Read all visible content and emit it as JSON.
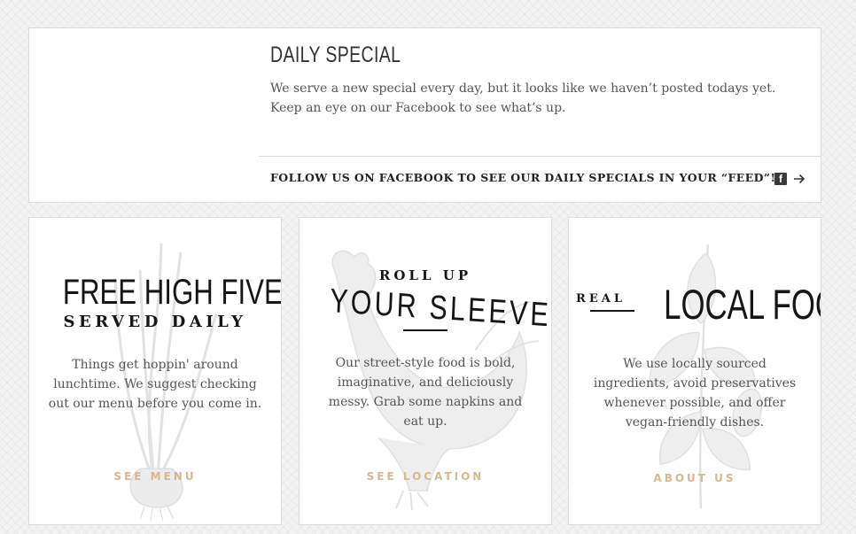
{
  "daily_special": {
    "title": "DAILY SPECIAL",
    "text": "We serve a new special every day, but it looks like we haven’t posted todays yet. Keep an eye on our Facebook to see what’s up.",
    "follow_text": "FOLLOW US ON FACEBOOK TO SEE OUR DAILY SPECIALS IN YOUR “FEED”!",
    "icons": [
      "facebook-icon",
      "arrow-right-icon"
    ]
  },
  "cards": [
    {
      "headline_main": "FREE HIGH FIVES",
      "headline_sub": "SERVED DAILY",
      "text": "Things get hoppin' around lunchtime. We suggest checking out our menu before you come in.",
      "link": "SEE MENU",
      "background_art": "scallion-illustration"
    },
    {
      "headline_top": "ROLL UP",
      "headline_main": "YOUR SLEEVES",
      "text": "Our street-style food is bold, imaginative, and deliciously messy. Grab some napkins and eat up.",
      "link": "SEE LOCATION",
      "background_art": "rooster-illustration"
    },
    {
      "headline_small": "REAL",
      "headline_main": "LOCAL FOOD",
      "text": "We use locally sourced ingredients, avoid preservatives whenever possible, and offer vegan-friendly dishes.",
      "link": "ABOUT US",
      "background_art": "herb-plant-illustration"
    }
  ],
  "colors": {
    "link": "#d7b88a",
    "headline": "#161616",
    "body_text": "#555555",
    "border": "#dcdcdc"
  }
}
